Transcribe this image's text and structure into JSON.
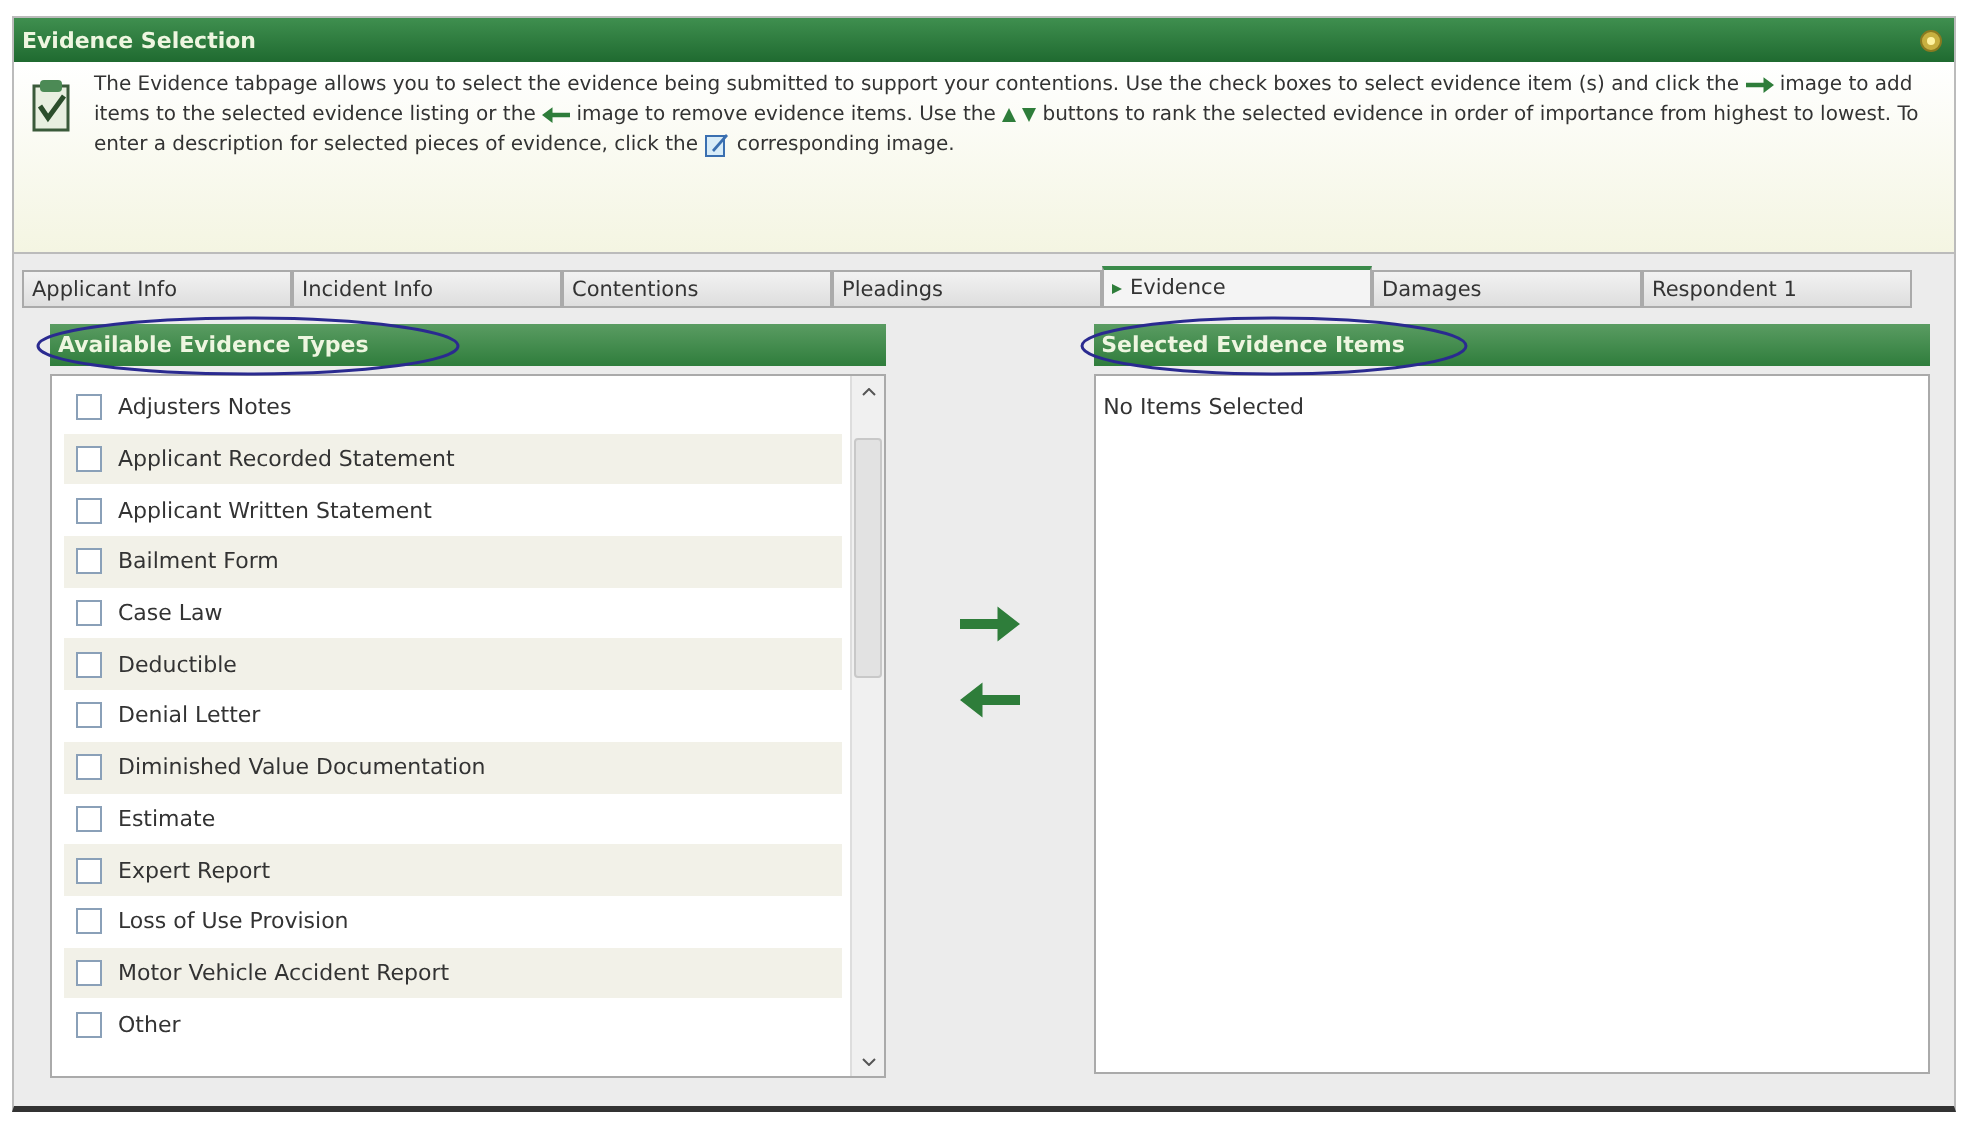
{
  "window": {
    "title": "Evidence Selection"
  },
  "info": [
    {
      "kind": "text",
      "text": "The Evidence tabpage allows you to select the evidence being submitted to support your contentions. Use the check boxes to select evidence item (s) and click the "
    },
    {
      "kind": "forward"
    },
    {
      "kind": "text",
      "text": " image to add items to the selected evidence listing or the "
    },
    {
      "kind": "back"
    },
    {
      "kind": "text",
      "text": " image to remove evidence items. Use the "
    },
    {
      "kind": "up"
    },
    {
      "kind": "down"
    },
    {
      "kind": "text",
      "text": " buttons to rank the selected evidence in order of importance from highest to lowest. To enter a description for selected pieces of evidence, click the "
    },
    {
      "kind": "edit"
    },
    {
      "kind": "text",
      "text": " corresponding image."
    }
  ],
  "tabs": [
    {
      "label": "Applicant Info",
      "selected": false
    },
    {
      "label": "Incident Info",
      "selected": false
    },
    {
      "label": "Contentions",
      "selected": false
    },
    {
      "label": "Pleadings",
      "selected": false
    },
    {
      "label": "Evidence",
      "selected": true
    },
    {
      "label": "Damages",
      "selected": false
    },
    {
      "label": "Respondent 1",
      "selected": false
    }
  ],
  "available": {
    "title": "Available Evidence Types",
    "items": [
      {
        "label": "Adjusters Notes",
        "checked": false
      },
      {
        "label": "Applicant Recorded Statement",
        "checked": false
      },
      {
        "label": "Applicant Written Statement",
        "checked": false
      },
      {
        "label": "Bailment Form",
        "checked": false
      },
      {
        "label": "Case Law",
        "checked": false
      },
      {
        "label": "Deductible",
        "checked": false
      },
      {
        "label": "Denial Letter",
        "checked": false
      },
      {
        "label": "Diminished Value Documentation",
        "checked": false
      },
      {
        "label": "Estimate",
        "checked": false
      },
      {
        "label": "Expert Report",
        "checked": false
      },
      {
        "label": "Loss of Use Provision",
        "checked": false
      },
      {
        "label": "Motor Vehicle Accident Report",
        "checked": false
      },
      {
        "label": "Other",
        "checked": false
      }
    ]
  },
  "selected_panel": {
    "title": "Selected Evidence Items",
    "empty_text": "No Items Selected"
  }
}
